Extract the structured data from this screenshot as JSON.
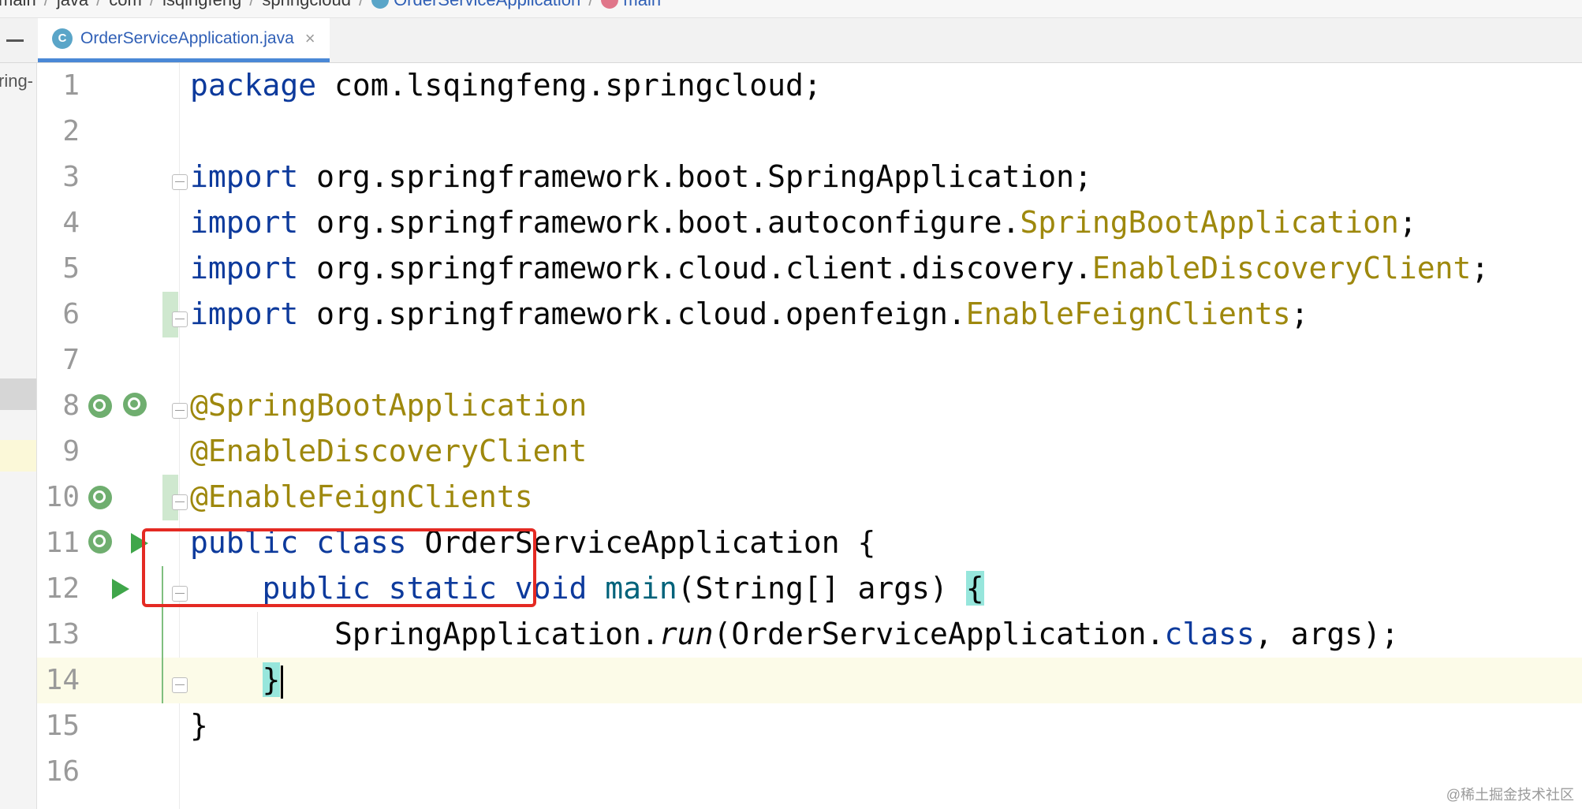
{
  "breadcrumb": [
    {
      "label": "main",
      "icon": null
    },
    {
      "label": "java",
      "icon": null
    },
    {
      "label": "com",
      "icon": null
    },
    {
      "label": "lsqingfeng",
      "icon": null
    },
    {
      "label": "springcloud",
      "icon": null
    },
    {
      "label": "OrderServiceApplication",
      "icon": "class-icon"
    },
    {
      "label": "main",
      "icon": "method-icon"
    }
  ],
  "tab": {
    "label": "OrderServiceApplication.java",
    "icon": "java-class-icon",
    "close": "×"
  },
  "project_panel": {
    "partial_text": "ring-"
  },
  "editor": {
    "current_line": 14,
    "lines": [
      {
        "n": "1"
      },
      {
        "n": "2"
      },
      {
        "n": "3"
      },
      {
        "n": "4"
      },
      {
        "n": "5"
      },
      {
        "n": "6"
      },
      {
        "n": "7"
      },
      {
        "n": "8"
      },
      {
        "n": "9"
      },
      {
        "n": "10"
      },
      {
        "n": "11"
      },
      {
        "n": "12"
      },
      {
        "n": "13"
      },
      {
        "n": "14"
      },
      {
        "n": "15"
      },
      {
        "n": "16"
      }
    ],
    "tokens": {
      "l1_kw": "package",
      "l1_rest": " com.lsqingfeng.springcloud;",
      "l3_kw": "import",
      "l3_rest": " org.springframework.boot.SpringApplication;",
      "l4_kw": "import",
      "l4_pkg": " org.springframework.boot.autoconfigure.",
      "l4_cls": "SpringBootApplication",
      "l4_end": ";",
      "l5_kw": "import",
      "l5_pkg": " org.springframework.cloud.client.discovery.",
      "l5_cls": "EnableDiscoveryClient",
      "l5_end": ";",
      "l6_kw": "import",
      "l6_pkg": " org.springframework.cloud.openfeign.",
      "l6_cls": "EnableFeignClients",
      "l6_end": ";",
      "l8_ann": "@SpringBootApplication",
      "l9_ann": "@EnableDiscoveryClient",
      "l10_ann": "@EnableFeignClients",
      "l11_kw": "public class",
      "l11_rest": " OrderServiceApplication {",
      "l12_indent": "    ",
      "l12_kw": "public static void",
      "l12_sp": " ",
      "l12_mth": "main",
      "l12_rest": "(String[] args) ",
      "l12_brace": "{",
      "l13_indent": "        ",
      "l13_a": "SpringApplication.",
      "l13_run": "run",
      "l13_b": "(OrderServiceApplication.",
      "l13_kw": "class",
      "l13_c": ", args);",
      "l14_indent": "    ",
      "l14_brace": "}",
      "l15_text": "}"
    }
  },
  "colors": {
    "keyword": "#0d3a9c",
    "annotation": "#9e880d",
    "highlight_box": "#e42a23",
    "tab_underline": "#4a88d6"
  },
  "watermark": "@稀土掘金技术社区"
}
